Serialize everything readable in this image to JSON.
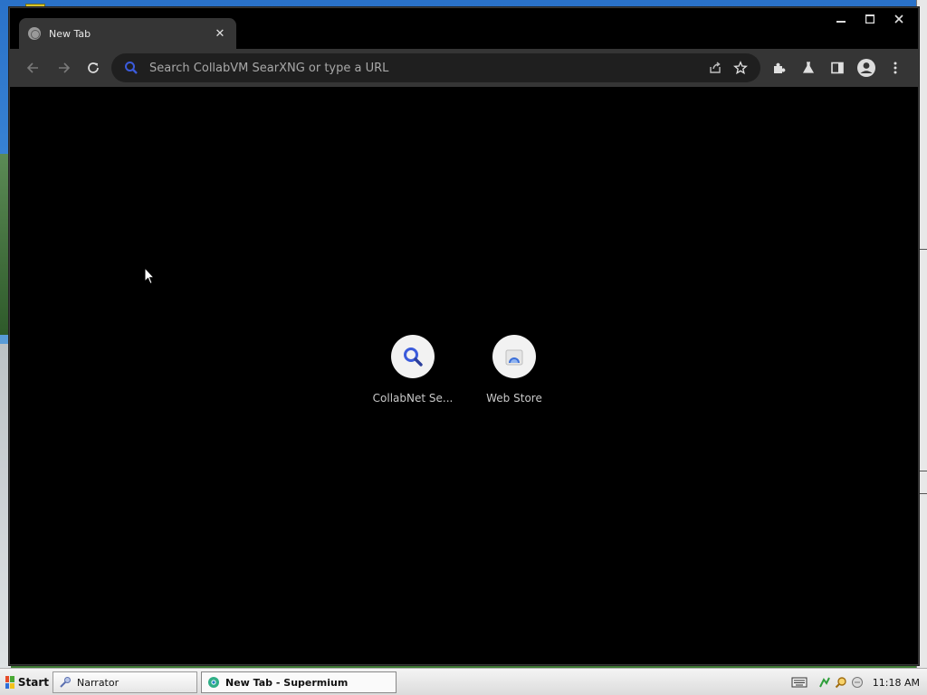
{
  "window": {
    "tab_title": "New Tab",
    "tab_close": "✕"
  },
  "toolbar": {
    "omnibox_placeholder": "Search CollabVM SearXNG or type a URL"
  },
  "shortcuts": [
    {
      "label": "CollabNet Se...",
      "icon": "search-icon"
    },
    {
      "label": "Web Store",
      "icon": "web-store-icon"
    }
  ],
  "taskbar": {
    "start_label": "Start",
    "tasks": [
      {
        "label": "Narrator",
        "icon": "narrator-icon"
      },
      {
        "label": "New Tab - Supermium",
        "icon": "browser-icon"
      }
    ],
    "clock": "11:18 AM"
  },
  "colors": {
    "accent": "#3b5bdb",
    "toolbar": "#353535",
    "omnibox": "#1f1f1f"
  }
}
